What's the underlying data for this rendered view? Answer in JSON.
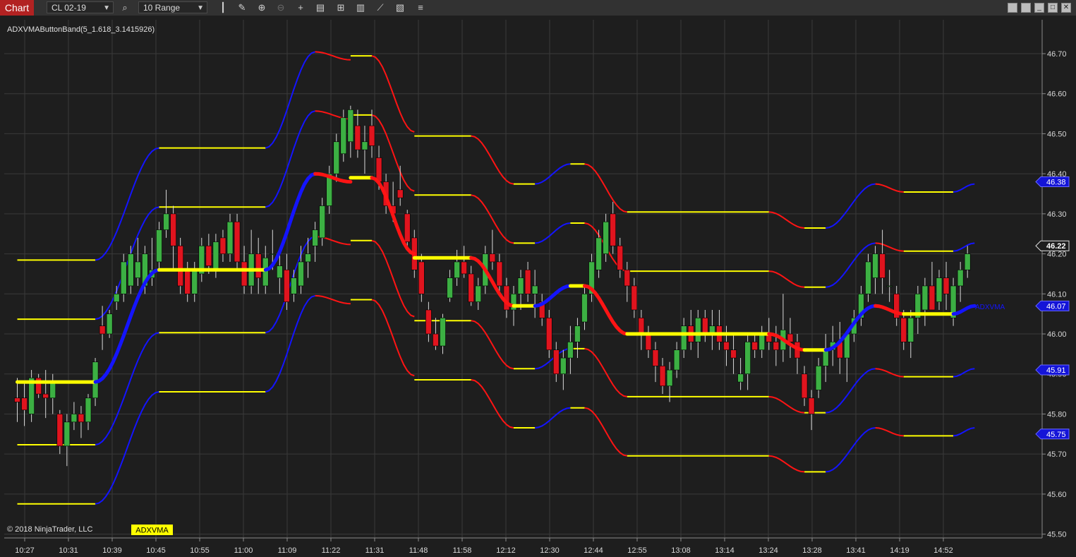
{
  "toolbar": {
    "chart_tab": "Chart",
    "instrument": "CL 02-19",
    "bar_type": "10 Range",
    "icons": [
      "search-icon",
      "bar-type-icon",
      "draw-icon",
      "zoom-in-icon",
      "zoom-out-icon",
      "crosshair-icon",
      "data-box-icon",
      "indicators-icon",
      "strategies-icon",
      "templates-icon",
      "properties-icon"
    ],
    "window_buttons": [
      "tile-icon",
      "minimize-icon",
      "maximize-icon",
      "close-icon"
    ]
  },
  "indicator_label": "ADXVMAButtonBand(5_1.618_3.1415926)",
  "copyright": "© 2018 NinjaTrader, LLC",
  "indicator_badge": "ADXVMA",
  "plot_label": "ADXVMA",
  "colors": {
    "up": "#3cb043",
    "down": "#e0141e",
    "rise": "#1414ff",
    "fall": "#ff1414",
    "flat": "#ffff00",
    "background": "#1e1e1e",
    "grid": "#3a3a3a"
  },
  "chart_data": {
    "type": "candlestick",
    "ylim": [
      45.5,
      46.72
    ],
    "y_ticks": [
      "46.70",
      "46.60",
      "46.50",
      "46.40",
      "46.30",
      "46.20",
      "46.10",
      "46.00",
      "45.90",
      "45.80",
      "45.70",
      "45.60",
      "45.50"
    ],
    "x_ticks": [
      "10:27",
      "10:31",
      "10:39",
      "10:45",
      "10:55",
      "11:00",
      "11:09",
      "11:22",
      "11:31",
      "11:48",
      "11:58",
      "12:12",
      "12:30",
      "12:44",
      "12:55",
      "13:08",
      "13:14",
      "13:24",
      "13:28",
      "13:41",
      "14:19",
      "14:52"
    ],
    "price_labels": [
      {
        "value": 46.38,
        "text": "46.38",
        "style": "blue"
      },
      {
        "value": 46.22,
        "text": "46.22",
        "style": "current"
      },
      {
        "value": 46.07,
        "text": "46.07",
        "style": "blue"
      },
      {
        "value": 45.91,
        "text": "45.91",
        "style": "blue"
      },
      {
        "value": 45.75,
        "text": "45.75",
        "style": "blue"
      }
    ],
    "candles": [
      [
        45.84,
        45.89,
        45.78,
        45.83
      ],
      [
        45.84,
        45.88,
        45.77,
        45.81
      ],
      [
        45.8,
        45.91,
        45.78,
        45.89
      ],
      [
        45.89,
        45.9,
        45.84,
        45.85
      ],
      [
        45.85,
        45.91,
        45.79,
        45.84
      ],
      [
        45.84,
        45.9,
        45.8,
        45.88
      ],
      [
        45.8,
        45.81,
        45.7,
        45.72
      ],
      [
        45.72,
        45.8,
        45.67,
        45.78
      ],
      [
        45.78,
        45.83,
        45.76,
        45.8
      ],
      [
        45.8,
        45.82,
        45.74,
        45.78
      ],
      [
        45.78,
        45.85,
        45.76,
        45.84
      ],
      [
        45.84,
        45.94,
        45.82,
        45.93
      ],
      [
        46.02,
        46.07,
        45.96,
        46.0
      ],
      [
        46.0,
        46.06,
        45.99,
        46.05
      ],
      [
        46.08,
        46.12,
        46.06,
        46.1
      ],
      [
        46.1,
        46.2,
        46.08,
        46.18
      ],
      [
        46.12,
        46.22,
        46.1,
        46.2
      ],
      [
        46.14,
        46.24,
        46.12,
        46.18
      ],
      [
        46.12,
        46.22,
        46.1,
        46.2
      ],
      [
        46.14,
        46.24,
        46.12,
        46.16
      ],
      [
        46.18,
        46.28,
        46.16,
        46.26
      ],
      [
        46.26,
        46.36,
        46.24,
        46.3
      ],
      [
        46.3,
        46.32,
        46.16,
        46.22
      ],
      [
        46.22,
        46.24,
        46.1,
        46.12
      ],
      [
        46.16,
        46.18,
        46.08,
        46.1
      ],
      [
        46.1,
        46.18,
        46.08,
        46.16
      ],
      [
        46.15,
        46.24,
        46.13,
        46.22
      ],
      [
        46.22,
        46.25,
        46.15,
        46.17
      ],
      [
        46.16,
        46.25,
        46.14,
        46.23
      ],
      [
        46.24,
        46.26,
        46.18,
        46.2
      ],
      [
        46.2,
        46.3,
        46.18,
        46.28
      ],
      [
        46.28,
        46.3,
        46.16,
        46.18
      ],
      [
        46.18,
        46.22,
        46.1,
        46.12
      ],
      [
        46.12,
        46.26,
        46.1,
        46.2
      ],
      [
        46.2,
        46.24,
        46.1,
        46.14
      ],
      [
        46.12,
        46.22,
        46.1,
        46.19
      ],
      [
        46.2,
        46.26,
        46.16,
        46.2
      ],
      [
        46.14,
        46.2,
        46.1,
        46.17
      ],
      [
        46.16,
        46.2,
        46.06,
        46.08
      ],
      [
        46.1,
        46.16,
        46.08,
        46.14
      ],
      [
        46.12,
        46.22,
        46.1,
        46.18
      ],
      [
        46.18,
        46.24,
        46.14,
        46.2
      ],
      [
        46.22,
        46.28,
        46.18,
        46.26
      ],
      [
        46.24,
        46.34,
        46.22,
        46.32
      ],
      [
        46.32,
        46.42,
        46.3,
        46.4
      ],
      [
        46.4,
        46.5,
        46.38,
        46.48
      ],
      [
        46.45,
        46.56,
        46.43,
        46.54
      ],
      [
        46.48,
        46.57,
        46.44,
        46.56
      ],
      [
        46.52,
        46.56,
        46.44,
        46.46
      ],
      [
        46.46,
        46.52,
        46.4,
        46.48
      ],
      [
        46.52,
        46.56,
        46.44,
        46.47
      ],
      [
        46.44,
        46.47,
        46.36,
        46.38
      ],
      [
        46.38,
        46.4,
        46.3,
        46.32
      ],
      [
        46.32,
        46.38,
        46.28,
        46.3
      ],
      [
        46.36,
        46.42,
        46.32,
        46.34
      ],
      [
        46.3,
        46.31,
        46.22,
        46.23
      ],
      [
        46.24,
        46.26,
        46.14,
        46.16
      ],
      [
        46.18,
        46.2,
        46.08,
        46.1
      ],
      [
        46.06,
        46.08,
        45.98,
        46.0
      ],
      [
        46.0,
        46.04,
        45.96,
        45.97
      ],
      [
        45.97,
        46.05,
        45.95,
        46.04
      ],
      [
        46.09,
        46.16,
        46.08,
        46.14
      ],
      [
        46.14,
        46.21,
        46.12,
        46.18
      ],
      [
        46.18,
        46.22,
        46.14,
        46.15
      ],
      [
        46.15,
        46.17,
        46.07,
        46.08
      ],
      [
        46.08,
        46.14,
        46.06,
        46.12
      ],
      [
        46.12,
        46.22,
        46.1,
        46.2
      ],
      [
        46.2,
        46.26,
        46.16,
        46.18
      ],
      [
        46.18,
        46.2,
        46.1,
        46.12
      ],
      [
        46.12,
        46.14,
        46.04,
        46.06
      ],
      [
        46.06,
        46.12,
        46.02,
        46.1
      ],
      [
        46.1,
        46.16,
        46.06,
        46.14
      ],
      [
        46.16,
        46.18,
        46.08,
        46.1
      ],
      [
        46.1,
        46.16,
        46.04,
        46.12
      ],
      [
        46.08,
        46.1,
        46.02,
        46.04
      ],
      [
        46.04,
        46.06,
        45.94,
        45.96
      ],
      [
        45.96,
        45.98,
        45.88,
        45.9
      ],
      [
        45.9,
        45.96,
        45.86,
        45.94
      ],
      [
        45.94,
        46.02,
        45.9,
        45.98
      ],
      [
        45.98,
        46.04,
        45.94,
        46.02
      ],
      [
        46.03,
        46.12,
        46.01,
        46.1
      ],
      [
        46.1,
        46.2,
        46.08,
        46.18
      ],
      [
        46.16,
        46.26,
        46.14,
        46.24
      ],
      [
        46.2,
        46.3,
        46.18,
        46.28
      ],
      [
        46.3,
        46.33,
        46.2,
        46.22
      ],
      [
        46.22,
        46.24,
        46.14,
        46.16
      ],
      [
        46.16,
        46.18,
        46.08,
        46.12
      ],
      [
        46.12,
        46.14,
        46.04,
        46.06
      ],
      [
        46.04,
        46.06,
        45.96,
        46.0
      ],
      [
        46.0,
        46.02,
        45.94,
        45.96
      ],
      [
        45.96,
        45.98,
        45.88,
        45.92
      ],
      [
        45.92,
        45.94,
        45.85,
        45.87
      ],
      [
        45.87,
        45.93,
        45.83,
        45.91
      ],
      [
        45.91,
        45.98,
        45.89,
        45.96
      ],
      [
        45.96,
        46.04,
        45.94,
        46.02
      ],
      [
        46.02,
        46.06,
        45.96,
        45.98
      ],
      [
        45.98,
        46.06,
        45.94,
        46.04
      ],
      [
        46.04,
        46.06,
        45.98,
        46.0
      ],
      [
        46.0,
        46.06,
        45.96,
        46.02
      ],
      [
        46.02,
        46.06,
        45.96,
        45.98
      ],
      [
        45.98,
        46.02,
        45.92,
        45.96
      ],
      [
        45.96,
        46.0,
        45.9,
        45.94
      ],
      [
        45.88,
        45.94,
        45.86,
        45.9
      ],
      [
        45.9,
        46.0,
        45.86,
        45.98
      ],
      [
        45.98,
        46.0,
        45.94,
        45.96
      ],
      [
        45.96,
        46.02,
        45.94,
        46.0
      ],
      [
        46.0,
        46.04,
        45.96,
        45.98
      ],
      [
        45.98,
        46.02,
        45.92,
        45.96
      ],
      [
        45.96,
        46.1,
        45.93,
        46.01
      ],
      [
        46.0,
        46.04,
        45.94,
        45.98
      ],
      [
        45.98,
        46.0,
        45.9,
        45.94
      ],
      [
        45.9,
        45.92,
        45.82,
        45.84
      ],
      [
        45.84,
        45.86,
        45.76,
        45.8
      ],
      [
        45.86,
        45.94,
        45.84,
        45.92
      ],
      [
        45.92,
        46.0,
        45.88,
        45.96
      ],
      [
        45.96,
        46.02,
        45.92,
        45.98
      ],
      [
        45.98,
        46.03,
        45.9,
        45.94
      ],
      [
        45.94,
        46.0,
        45.88,
        46.0
      ],
      [
        46.0,
        46.06,
        45.98,
        46.04
      ],
      [
        46.04,
        46.12,
        46.02,
        46.1
      ],
      [
        46.1,
        46.2,
        46.08,
        46.18
      ],
      [
        46.14,
        46.22,
        46.1,
        46.2
      ],
      [
        46.2,
        46.26,
        46.1,
        46.14
      ],
      [
        46.12,
        46.16,
        46.08,
        46.12
      ],
      [
        46.1,
        46.12,
        46.02,
        46.04
      ],
      [
        46.04,
        46.06,
        45.96,
        45.98
      ],
      [
        45.98,
        46.06,
        45.94,
        46.04
      ],
      [
        46.04,
        46.12,
        46.0,
        46.1
      ],
      [
        46.06,
        46.14,
        46.02,
        46.12
      ],
      [
        46.12,
        46.18,
        46.08,
        46.06
      ],
      [
        46.08,
        46.16,
        46.06,
        46.14
      ],
      [
        46.14,
        46.18,
        46.06,
        46.1
      ],
      [
        46.04,
        46.14,
        46.02,
        46.12
      ],
      [
        46.12,
        46.18,
        46.08,
        46.16
      ],
      [
        46.16,
        46.22,
        46.14,
        46.2
      ]
    ],
    "adxvma": {
      "width_main": 5,
      "width_band": 2,
      "segments": [
        {
          "bars": [
            0,
            11
          ],
          "value": 45.88,
          "state": "flat"
        },
        {
          "bars": [
            11,
            20
          ],
          "value": [
            45.88,
            46.16
          ],
          "state": "rise"
        },
        {
          "bars": [
            20,
            35
          ],
          "value": 46.16,
          "state": "flat"
        },
        {
          "bars": [
            35,
            42
          ],
          "value": [
            46.16,
            46.4
          ],
          "state": "rise"
        },
        {
          "bars": [
            42,
            47
          ],
          "value": [
            46.4,
            46.38
          ],
          "state": "fall"
        },
        {
          "bars": [
            47,
            50
          ],
          "value": 46.39,
          "state": "flat"
        },
        {
          "bars": [
            50,
            56
          ],
          "value": [
            46.39,
            46.2
          ],
          "state": "fall"
        },
        {
          "bars": [
            56,
            64
          ],
          "value": 46.19,
          "state": "flat"
        },
        {
          "bars": [
            64,
            70
          ],
          "value": [
            46.19,
            46.07
          ],
          "state": "fall"
        },
        {
          "bars": [
            70,
            73
          ],
          "value": 46.07,
          "state": "flat"
        },
        {
          "bars": [
            73,
            78
          ],
          "value": [
            46.07,
            46.12
          ],
          "state": "rise"
        },
        {
          "bars": [
            78,
            80
          ],
          "value": 46.12,
          "state": "flat"
        },
        {
          "bars": [
            80,
            86
          ],
          "value": [
            46.12,
            46.0
          ],
          "state": "fall"
        },
        {
          "bars": [
            86,
            106
          ],
          "value": 46.0,
          "state": "flat"
        },
        {
          "bars": [
            106,
            111
          ],
          "value": [
            46.0,
            45.96
          ],
          "state": "fall"
        },
        {
          "bars": [
            111,
            114
          ],
          "value": 45.96,
          "state": "flat"
        },
        {
          "bars": [
            114,
            121
          ],
          "value": [
            45.96,
            46.07
          ],
          "state": "rise"
        },
        {
          "bars": [
            121,
            125
          ],
          "value": [
            46.07,
            46.05
          ],
          "state": "fall"
        },
        {
          "bars": [
            125,
            132
          ],
          "value": 46.05,
          "state": "flat"
        },
        {
          "bars": [
            132,
            135
          ],
          "value": [
            46.05,
            46.07
          ],
          "state": "rise"
        }
      ]
    },
    "bands_offsets": [
      0.3045,
      0.1568,
      -0.1568,
      -0.3045
    ]
  }
}
